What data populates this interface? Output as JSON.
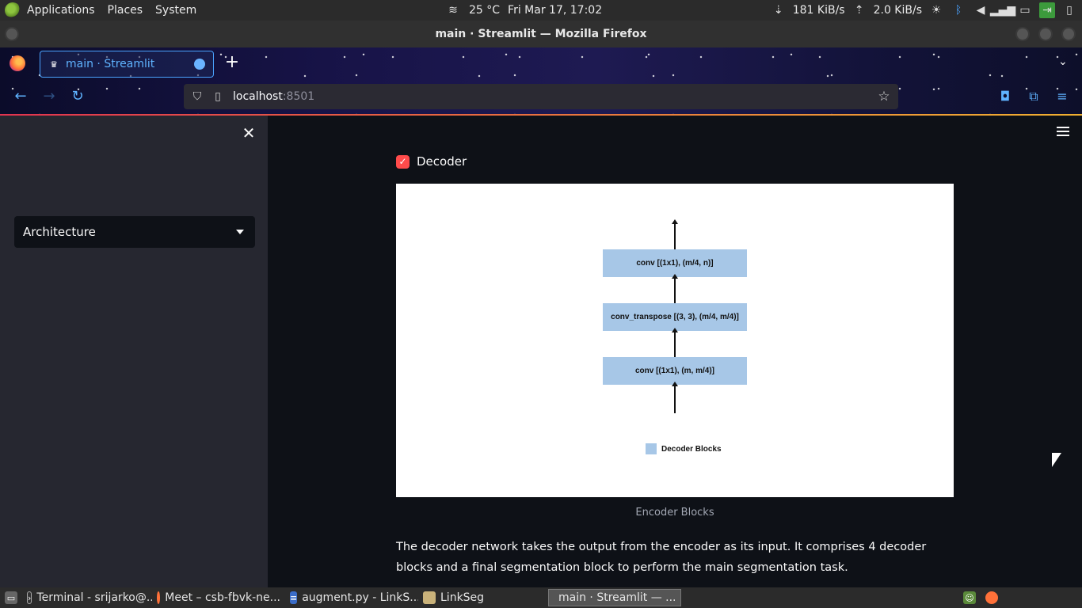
{
  "system_panel": {
    "menus": [
      "Applications",
      "Places",
      "System"
    ],
    "weather": "25 °C",
    "datetime": "Fri Mar 17, 17:02",
    "net_down": "181 KiB/s",
    "net_up": "2.0 KiB/s"
  },
  "window": {
    "title": "main · Streamlit — Mozilla Firefox"
  },
  "browser": {
    "tab_title": "main · Streamlit",
    "url_host": "localhost",
    "url_port": ":8501"
  },
  "sidebar": {
    "select_value": "Architecture"
  },
  "main": {
    "checkbox_label": "Decoder",
    "checkbox_checked": true,
    "figure": {
      "blocks": [
        "conv [(1x1), (m/4, n)]",
        "conv_transpose  [(3, 3), (m/4, m/4)]",
        "conv [(1x1), (m, m/4)]"
      ],
      "legend": "Decoder Blocks",
      "block_color": "#a7c7e7"
    },
    "caption": "Encoder Blocks",
    "paragraph": "The decoder network takes the output from the encoder as its input. It comprises 4 decoder blocks and a final segmentation block to perform the main segmentation task."
  },
  "taskbar": {
    "items": [
      "Terminal - srijarko@...",
      "Meet – csb-fbvk-ne...",
      "augment.py - LinkS...",
      "LinkSeg",
      "main · Streamlit — ..."
    ]
  },
  "colors": {
    "accent": "#ff4b4b",
    "app_bg": "#0e1117",
    "sidebar_bg": "#262730",
    "link_blue": "#5fb3ff"
  }
}
